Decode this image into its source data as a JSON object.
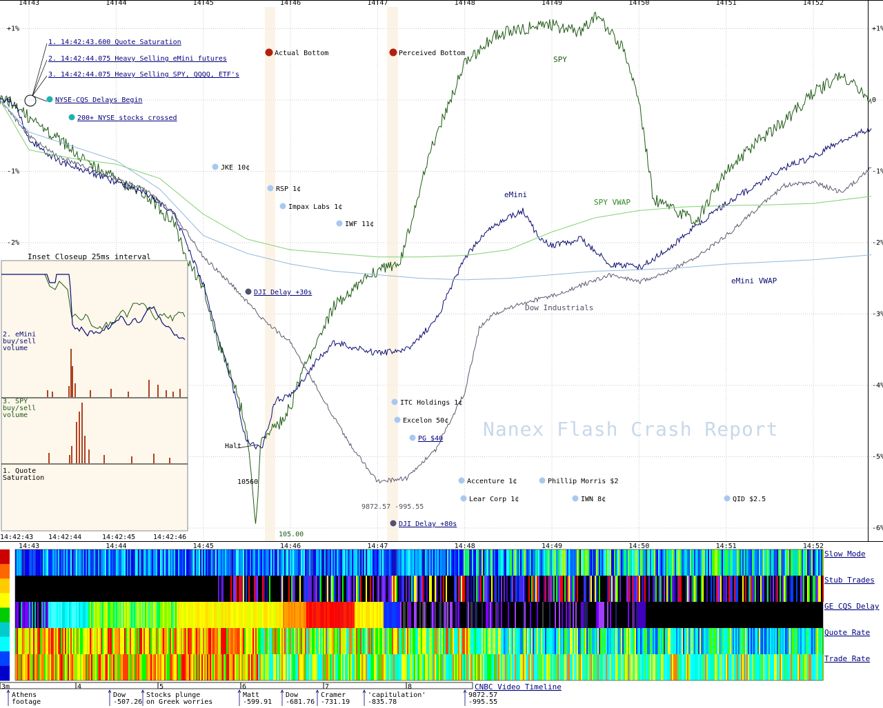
{
  "chart_data": [
    {
      "type": "line",
      "x_unit": "time",
      "x_ticks": [
        "14:43",
        "14:44",
        "14:45",
        "14:46",
        "14:47",
        "14:48",
        "14:49",
        "14:50",
        "14:51",
        "14:52"
      ],
      "xlim": [
        "14:42:40",
        "14:52:48"
      ],
      "y_ticks": [
        "+1%",
        "0",
        "-1%",
        "-2%",
        "-3%",
        "-4%",
        "-5%",
        "-6%"
      ],
      "ylim_pct": [
        1.05,
        -6.1
      ],
      "grid": true,
      "series": [
        {
          "name": "SPY",
          "color": "#1d5a12",
          "points": [
            [
              "14:42:40",
              0.0
            ],
            [
              "14:42:50",
              -0.03
            ],
            [
              "14:43:00",
              -0.25
            ],
            [
              "14:43:20",
              -0.55
            ],
            [
              "14:43:40",
              -0.85
            ],
            [
              "14:44:00",
              -1.12
            ],
            [
              "14:44:20",
              -1.3
            ],
            [
              "14:44:40",
              -1.75
            ],
            [
              "14:44:50",
              -2.3
            ],
            [
              "14:45:00",
              -2.6
            ],
            [
              "14:45:10",
              -3.4
            ],
            [
              "14:45:20",
              -3.9
            ],
            [
              "14:45:30",
              -4.6
            ],
            [
              "14:45:36",
              -6.0
            ],
            [
              "14:45:40",
              -4.7
            ],
            [
              "14:45:50",
              -4.6
            ],
            [
              "14:46:00",
              -4.3
            ],
            [
              "14:46:10",
              -3.7
            ],
            [
              "14:46:20",
              -3.3
            ],
            [
              "14:46:30",
              -2.9
            ],
            [
              "14:46:40",
              -2.7
            ],
            [
              "14:46:50",
              -2.5
            ],
            [
              "14:47:00",
              -2.4
            ],
            [
              "14:47:15",
              -2.3
            ],
            [
              "14:47:30",
              -1.2
            ],
            [
              "14:47:40",
              -0.5
            ],
            [
              "14:47:50",
              0.0
            ],
            [
              "14:48:00",
              0.5
            ],
            [
              "14:48:10",
              0.7
            ],
            [
              "14:48:20",
              0.9
            ],
            [
              "14:48:40",
              1.0
            ],
            [
              "14:49:00",
              1.05
            ],
            [
              "14:49:20",
              0.95
            ],
            [
              "14:49:30",
              1.2
            ],
            [
              "14:49:50",
              0.7
            ],
            [
              "14:50:00",
              0.0
            ],
            [
              "14:50:10",
              -1.4
            ],
            [
              "14:50:20",
              -1.5
            ],
            [
              "14:50:40",
              -1.7
            ],
            [
              "14:51:00",
              -1.0
            ],
            [
              "14:51:20",
              -0.6
            ],
            [
              "14:51:40",
              -0.3
            ],
            [
              "14:52:00",
              0.1
            ],
            [
              "14:52:20",
              0.35
            ],
            [
              "14:52:40",
              -0.05
            ]
          ]
        },
        {
          "name": "eMini",
          "color": "#0a0a70",
          "points": [
            [
              "14:42:40",
              0.0
            ],
            [
              "14:42:50",
              -0.05
            ],
            [
              "14:43:00",
              -0.55
            ],
            [
              "14:43:20",
              -0.85
            ],
            [
              "14:43:40",
              -1.0
            ],
            [
              "14:44:00",
              -1.15
            ],
            [
              "14:44:20",
              -1.3
            ],
            [
              "14:44:40",
              -1.6
            ],
            [
              "14:44:50",
              -2.1
            ],
            [
              "14:45:00",
              -2.6
            ],
            [
              "14:45:10",
              -3.3
            ],
            [
              "14:45:20",
              -4.0
            ],
            [
              "14:45:30",
              -4.8
            ],
            [
              "14:45:40",
              -4.9
            ],
            [
              "14:45:50",
              -4.2
            ],
            [
              "14:46:00",
              -4.15
            ],
            [
              "14:46:10",
              -3.9
            ],
            [
              "14:46:20",
              -3.6
            ],
            [
              "14:46:30",
              -3.4
            ],
            [
              "14:46:40",
              -3.45
            ],
            [
              "14:47:00",
              -3.55
            ],
            [
              "14:47:20",
              -3.5
            ],
            [
              "14:47:40",
              -3.1
            ],
            [
              "14:48:00",
              -2.2
            ],
            [
              "14:48:20",
              -1.75
            ],
            [
              "14:48:40",
              -1.55
            ],
            [
              "14:48:50",
              -1.9
            ],
            [
              "14:49:00",
              -2.05
            ],
            [
              "14:49:20",
              -1.95
            ],
            [
              "14:49:40",
              -2.3
            ],
            [
              "14:50:00",
              -2.35
            ],
            [
              "14:50:20",
              -2.1
            ],
            [
              "14:50:40",
              -1.75
            ],
            [
              "14:51:00",
              -1.45
            ],
            [
              "14:51:20",
              -1.2
            ],
            [
              "14:51:40",
              -0.95
            ],
            [
              "14:52:00",
              -0.8
            ],
            [
              "14:52:20",
              -0.55
            ],
            [
              "14:52:40",
              -0.4
            ]
          ]
        },
        {
          "name": "Dow Industrials",
          "color": "#5a5a70",
          "points": [
            [
              "14:42:40",
              0.0
            ],
            [
              "14:43:00",
              -0.5
            ],
            [
              "14:43:20",
              -0.8
            ],
            [
              "14:43:40",
              -0.95
            ],
            [
              "14:44:00",
              -1.1
            ],
            [
              "14:44:20",
              -1.25
            ],
            [
              "14:44:40",
              -1.6
            ],
            [
              "14:45:00",
              -2.2
            ],
            [
              "14:45:20",
              -2.6
            ],
            [
              "14:45:40",
              -3.05
            ],
            [
              "14:46:00",
              -3.4
            ],
            [
              "14:46:20",
              -4.1
            ],
            [
              "14:46:40",
              -4.8
            ],
            [
              "14:47:00",
              -5.35
            ],
            [
              "14:47:20",
              -5.3
            ],
            [
              "14:47:40",
              -4.9
            ],
            [
              "14:48:00",
              -4.1
            ],
            [
              "14:48:10",
              -3.2
            ],
            [
              "14:48:20",
              -3.0
            ],
            [
              "14:48:40",
              -2.85
            ],
            [
              "14:49:00",
              -2.75
            ],
            [
              "14:49:20",
              -2.6
            ],
            [
              "14:49:40",
              -2.45
            ],
            [
              "14:50:00",
              -2.55
            ],
            [
              "14:50:20",
              -2.4
            ],
            [
              "14:50:40",
              -2.2
            ],
            [
              "14:51:00",
              -1.9
            ],
            [
              "14:51:20",
              -1.55
            ],
            [
              "14:51:40",
              -1.2
            ],
            [
              "14:52:00",
              -1.15
            ],
            [
              "14:52:20",
              -1.3
            ],
            [
              "14:52:40",
              -0.95
            ]
          ]
        },
        {
          "name": "SPY VWAP",
          "color": "#80d070",
          "points": [
            [
              "14:42:40",
              0.0
            ],
            [
              "14:43:00",
              -0.7
            ],
            [
              "14:43:30",
              -0.82
            ],
            [
              "14:44:00",
              -0.9
            ],
            [
              "14:44:30",
              -1.1
            ],
            [
              "14:45:00",
              -1.6
            ],
            [
              "14:45:30",
              -1.95
            ],
            [
              "14:46:00",
              -2.1
            ],
            [
              "14:46:30",
              -2.15
            ],
            [
              "14:47:00",
              -2.2
            ],
            [
              "14:47:30",
              -2.2
            ],
            [
              "14:48:00",
              -2.18
            ],
            [
              "14:48:30",
              -2.1
            ],
            [
              "14:49:00",
              -1.85
            ],
            [
              "14:49:30",
              -1.65
            ],
            [
              "14:50:00",
              -1.55
            ],
            [
              "14:50:30",
              -1.5
            ],
            [
              "14:51:00",
              -1.48
            ],
            [
              "14:51:30",
              -1.47
            ],
            [
              "14:52:00",
              -1.45
            ],
            [
              "14:52:40",
              -1.35
            ]
          ]
        },
        {
          "name": "eMini VWAP",
          "color": "#90b8d8",
          "points": [
            [
              "14:42:40",
              0.0
            ],
            [
              "14:43:00",
              -0.45
            ],
            [
              "14:43:30",
              -0.65
            ],
            [
              "14:44:00",
              -0.85
            ],
            [
              "14:44:30",
              -1.25
            ],
            [
              "14:45:00",
              -1.9
            ],
            [
              "14:45:30",
              -2.15
            ],
            [
              "14:46:00",
              -2.3
            ],
            [
              "14:46:30",
              -2.4
            ],
            [
              "14:47:00",
              -2.45
            ],
            [
              "14:47:30",
              -2.5
            ],
            [
              "14:48:00",
              -2.52
            ],
            [
              "14:48:30",
              -2.5
            ],
            [
              "14:49:00",
              -2.45
            ],
            [
              "14:49:30",
              -2.4
            ],
            [
              "14:50:00",
              -2.38
            ],
            [
              "14:50:30",
              -2.35
            ],
            [
              "14:51:00",
              -2.3
            ],
            [
              "14:51:30",
              -2.27
            ],
            [
              "14:52:00",
              -2.24
            ],
            [
              "14:52:40",
              -2.17
            ]
          ]
        }
      ],
      "annotations": [
        {
          "text": "1. 14:42:43.600 Quote Saturation",
          "style": "link"
        },
        {
          "text": "2. 14:42:44.075 Heavy Selling eMini futures",
          "style": "link"
        },
        {
          "text": "3. 14:42:44.075 Heavy Selling SPY, QQQQ, ETF's",
          "style": "link"
        },
        {
          "text": "NYSE-CQS Delays Begin",
          "style": "link",
          "dot": "#20b0b0"
        },
        {
          "text": "200+ NYSE stocks crossed",
          "style": "link",
          "dot": "#20b0b0"
        },
        {
          "text": "Actual Bottom",
          "dot": "#b02010"
        },
        {
          "text": "Perceived Bottom",
          "dot": "#b02010"
        },
        {
          "text": "JKE 10¢",
          "dot": "#a8c8f0"
        },
        {
          "text": "RSP 1¢",
          "dot": "#a8c8f0"
        },
        {
          "text": "Impax Labs 1¢",
          "dot": "#a8c8f0"
        },
        {
          "text": "IWF 11¢",
          "dot": "#a8c8f0"
        },
        {
          "text": "DJI Delay +30s",
          "style": "link",
          "dot": "#505070"
        },
        {
          "text": "ITC Holdings 1¢",
          "dot": "#a8c8f0"
        },
        {
          "text": "Excelon 50¢",
          "dot": "#a8c8f0"
        },
        {
          "text": "PG $40",
          "style": "link",
          "dot": "#a8c8f0"
        },
        {
          "text": "Accenture 1¢",
          "dot": "#a8c8f0"
        },
        {
          "text": "Phillip Morris $2",
          "dot": "#a8c8f0"
        },
        {
          "text": "Lear Corp 1¢",
          "dot": "#a8c8f0"
        },
        {
          "text": "IWN 8¢",
          "dot": "#a8c8f0"
        },
        {
          "text": "QID $2.5",
          "dot": "#a8c8f0"
        },
        {
          "text": "DJI Delay +80s",
          "style": "link",
          "dot": "#505070"
        },
        {
          "text": "Halt"
        },
        {
          "text": "10560"
        },
        {
          "text": "105.00"
        },
        {
          "text": "9872.57 -995.55"
        }
      ],
      "watermark": "Nanex Flash Crash Report"
    },
    {
      "type": "line",
      "title": "Inset Closeup 25ms interval",
      "x_ticks": [
        "14:42:43",
        "14:42:44",
        "14:42:45",
        "14:42:46"
      ],
      "panels": [
        {
          "label": "2. eMini buy/sell volume",
          "color": "#0a0a70"
        },
        {
          "label": "3. SPY buy/sell volume",
          "color": "#1d5a12"
        },
        {
          "label": "1. Quote Saturation"
        }
      ]
    },
    {
      "type": "heatmap",
      "rows": [
        "Slow Mode",
        "Stub Trades",
        "GE CQS Delay",
        "Quote Rate",
        "Trade Rate"
      ],
      "scale_colors": [
        "#cc0000",
        "#ff6600",
        "#ffcc00",
        "#ffff00",
        "#00cc00",
        "#00cccc",
        "#00ffff",
        "#0044ff",
        "#0000cc"
      ]
    }
  ],
  "timeline": {
    "title": "CNBC Video Timeline",
    "ticks": [
      "3m",
      "4",
      "5",
      "6",
      "7",
      "8"
    ],
    "events": [
      {
        "line1": "Athens",
        "line2": "footage"
      },
      {
        "line1": "Dow",
        "line2": "-507.26"
      },
      {
        "line1": "Stocks plunge",
        "line2": "on Greek worries"
      },
      {
        "line1": "Matt",
        "line2": "-599.91"
      },
      {
        "line1": "Dow",
        "line2": "-681.76"
      },
      {
        "line1": "Cramer",
        "line2": "-731.19"
      },
      {
        "line1": "'capitulation'",
        "line2": "-835.78"
      },
      {
        "line1": "9872.57",
        "line2": "-995.55"
      }
    ]
  }
}
